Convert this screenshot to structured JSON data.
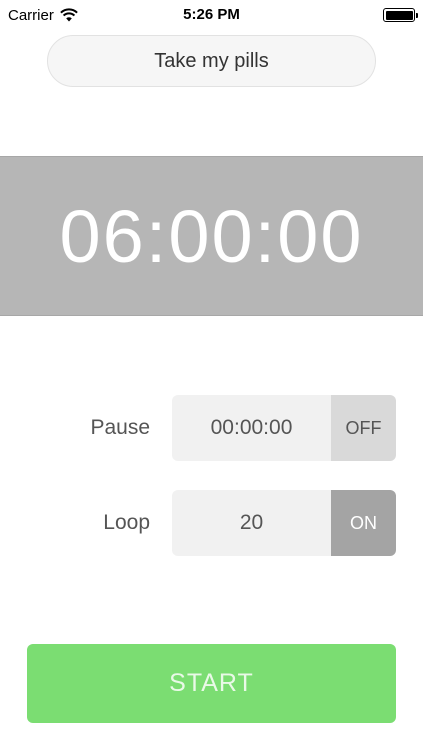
{
  "status_bar": {
    "carrier": "Carrier",
    "time": "5:26 PM",
    "wifi_icon": "wifi-icon",
    "battery_icon": "battery-full-icon"
  },
  "title": {
    "value": "Take my pills"
  },
  "timer": {
    "display": "06:00:00"
  },
  "pause": {
    "label": "Pause",
    "value": "00:00:00",
    "toggle": "OFF"
  },
  "loop": {
    "label": "Loop",
    "value": "20",
    "toggle": "ON"
  },
  "start_button": {
    "label": "START"
  },
  "colors": {
    "timer_background": "#b6b6b6",
    "start_green": "#7bdd72",
    "toggle_off": "#d9d9d9",
    "toggle_on": "#a4a4a4"
  }
}
